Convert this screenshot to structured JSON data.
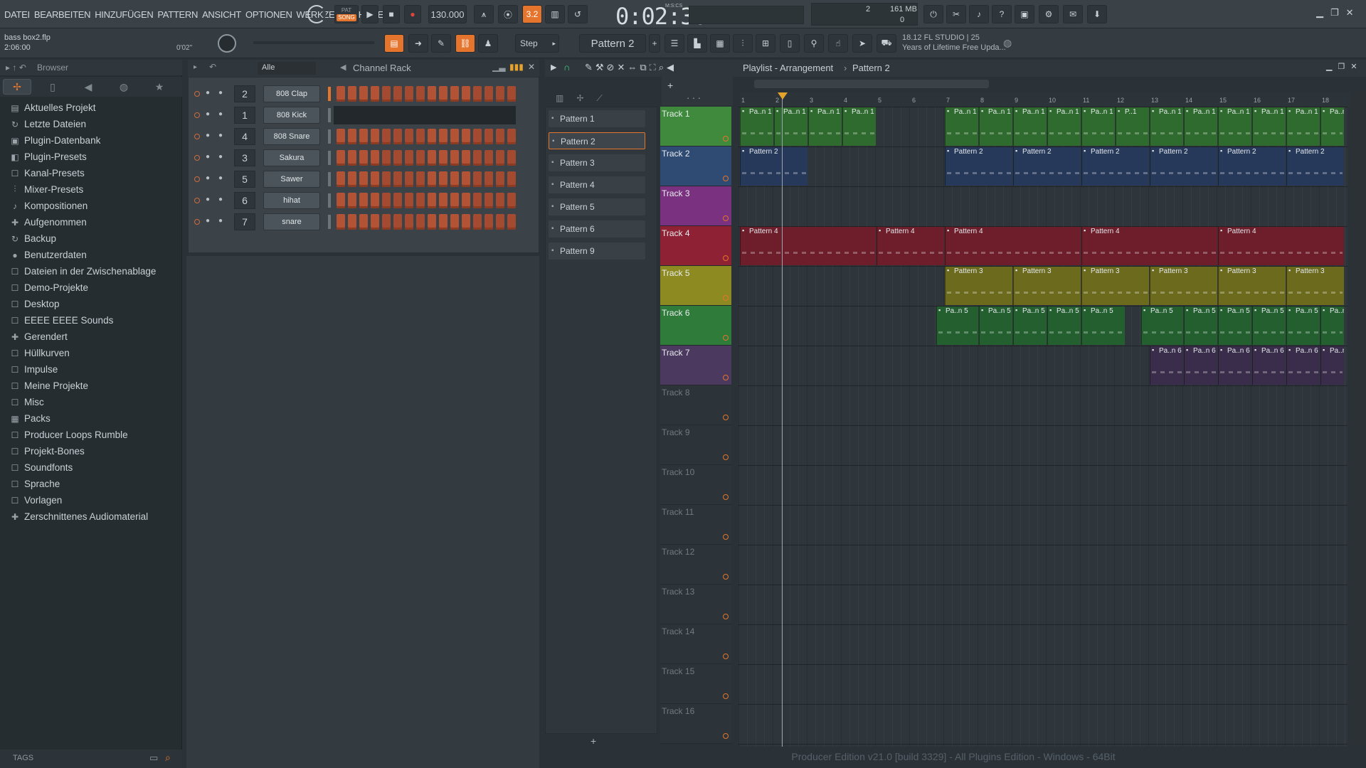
{
  "menu": [
    "DATEI",
    "BEARBEITEN",
    "HINZUFÜGEN",
    "PATTERN",
    "ANSICHT",
    "OPTIONEN",
    "WERKZEUGE",
    "HILFE"
  ],
  "transport": {
    "pat_label": "PAT",
    "song_label": "SONG",
    "tempo": "130.000",
    "time": "0:02:30",
    "time_unit": "M:S:CS",
    "cpu": "2",
    "mem": "161 MB",
    "poly": "0"
  },
  "project": {
    "file": "bass box2.flp",
    "length": "2:06:00",
    "hint_time": "0'02\""
  },
  "snap": "Step",
  "current_pattern": "Pattern 2",
  "news": {
    "line1": "18.12  FL STUDIO | 25",
    "line2": "Years of Lifetime Free Upda..."
  },
  "browser": {
    "title": "Browser",
    "items": [
      {
        "icon": "▤",
        "label": "Aktuelles Projekt"
      },
      {
        "icon": "↻",
        "label": "Letzte Dateien"
      },
      {
        "icon": "▣",
        "label": "Plugin-Datenbank"
      },
      {
        "icon": "◧",
        "label": "Plugin-Presets"
      },
      {
        "icon": "☐",
        "label": "Kanal-Presets"
      },
      {
        "icon": "⫶",
        "label": "Mixer-Presets"
      },
      {
        "icon": "♪",
        "label": "Kompositionen"
      },
      {
        "icon": "✚",
        "label": "Aufgenommen"
      },
      {
        "icon": "↻",
        "label": "Backup"
      },
      {
        "icon": "●",
        "label": "Benutzerdaten"
      },
      {
        "icon": "☐",
        "label": "Dateien in der Zwischenablage"
      },
      {
        "icon": "☐",
        "label": "Demo-Projekte"
      },
      {
        "icon": "☐",
        "label": "Desktop"
      },
      {
        "icon": "☐",
        "label": "EEEE EEEE Sounds"
      },
      {
        "icon": "✚",
        "label": "Gerendert"
      },
      {
        "icon": "☐",
        "label": "Hüllkurven"
      },
      {
        "icon": "☐",
        "label": "Impulse"
      },
      {
        "icon": "☐",
        "label": "Meine Projekte"
      },
      {
        "icon": "☐",
        "label": "Misc"
      },
      {
        "icon": "▦",
        "label": "Packs"
      },
      {
        "icon": "☐",
        "label": "Producer Loops Rumble"
      },
      {
        "icon": "☐",
        "label": "Projekt-Bones"
      },
      {
        "icon": "☐",
        "label": "Soundfonts"
      },
      {
        "icon": "☐",
        "label": "Sprache"
      },
      {
        "icon": "☐",
        "label": "Vorlagen"
      },
      {
        "icon": "✚",
        "label": "Zerschnittenes Audiomaterial"
      }
    ],
    "tags_label": "TAGS"
  },
  "channel_rack": {
    "filter": "Alle",
    "title": "Channel Rack",
    "add": "+",
    "channels": [
      {
        "num": "2",
        "name": "808 Clap",
        "empty": false
      },
      {
        "num": "1",
        "name": "808 Kick",
        "empty": true
      },
      {
        "num": "4",
        "name": "808 Snare",
        "empty": false
      },
      {
        "num": "3",
        "name": "Sakura",
        "empty": false
      },
      {
        "num": "5",
        "name": "Sawer",
        "empty": false
      },
      {
        "num": "6",
        "name": "hihat",
        "empty": false
      },
      {
        "num": "7",
        "name": "snare",
        "empty": false
      }
    ]
  },
  "patterns": [
    "Pattern 1",
    "Pattern 2",
    "Pattern 3",
    "Pattern 4",
    "Pattern 5",
    "Pattern 6",
    "Pattern 9"
  ],
  "active_pattern_index": 1,
  "playlist": {
    "title": "Playlist - Arrangement",
    "crumb": "Pattern 2",
    "bars": [
      "1",
      "2",
      "3",
      "4",
      "5",
      "6",
      "7",
      "8",
      "9",
      "10",
      "11",
      "12",
      "13",
      "14",
      "15",
      "16",
      "17",
      "18"
    ],
    "tracks": [
      {
        "name": "Track 1",
        "color": "#3f8a3c"
      },
      {
        "name": "Track 2",
        "color": "#2f4a73"
      },
      {
        "name": "Track 3",
        "color": "#7a3180"
      },
      {
        "name": "Track 4",
        "color": "#8e2234"
      },
      {
        "name": "Track 5",
        "color": "#8e8a22"
      },
      {
        "name": "Track 6",
        "color": "#2e7b3a"
      },
      {
        "name": "Track 7",
        "color": "#4b3960"
      },
      {
        "name": "Track 8",
        "color": ""
      },
      {
        "name": "Track 9",
        "color": ""
      },
      {
        "name": "Track 10",
        "color": ""
      },
      {
        "name": "Track 11",
        "color": ""
      },
      {
        "name": "Track 12",
        "color": ""
      },
      {
        "name": "Track 13",
        "color": ""
      },
      {
        "name": "Track 14",
        "color": ""
      },
      {
        "name": "Track 15",
        "color": ""
      },
      {
        "name": "Track 16",
        "color": ""
      }
    ],
    "clips": [
      {
        "track": 0,
        "bar": 1,
        "len": 1,
        "label": "Pa..n 1",
        "color": "#2f6b2e"
      },
      {
        "track": 0,
        "bar": 2,
        "len": 1,
        "label": "Pa..n 1",
        "color": "#2f6b2e"
      },
      {
        "track": 0,
        "bar": 3,
        "len": 1,
        "label": "Pa..n 1",
        "color": "#2f6b2e"
      },
      {
        "track": 0,
        "bar": 4,
        "len": 1,
        "label": "Pa..n 1",
        "color": "#2f6b2e"
      },
      {
        "track": 0,
        "bar": 7,
        "len": 1,
        "label": "Pa..n 1",
        "color": "#2f6b2e"
      },
      {
        "track": 0,
        "bar": 8,
        "len": 1,
        "label": "Pa..n 1",
        "color": "#2f6b2e"
      },
      {
        "track": 0,
        "bar": 9,
        "len": 1,
        "label": "Pa..n 1",
        "color": "#2f6b2e"
      },
      {
        "track": 0,
        "bar": 10,
        "len": 1,
        "label": "Pa..n 1",
        "color": "#2f6b2e"
      },
      {
        "track": 0,
        "bar": 11,
        "len": 1,
        "label": "Pa..n 1",
        "color": "#2f6b2e"
      },
      {
        "track": 0,
        "bar": 12,
        "len": 1,
        "label": "P..1",
        "color": "#2f6b2e"
      },
      {
        "track": 0,
        "bar": 13,
        "len": 1,
        "label": "Pa..n 1",
        "color": "#2f6b2e"
      },
      {
        "track": 0,
        "bar": 14,
        "len": 1,
        "label": "Pa..n 1",
        "color": "#2f6b2e"
      },
      {
        "track": 0,
        "bar": 15,
        "len": 1,
        "label": "Pa..n 1",
        "color": "#2f6b2e"
      },
      {
        "track": 0,
        "bar": 16,
        "len": 1,
        "label": "Pa..n 1",
        "color": "#2f6b2e"
      },
      {
        "track": 0,
        "bar": 17,
        "len": 1,
        "label": "Pa..n 1",
        "color": "#2f6b2e"
      },
      {
        "track": 0,
        "bar": 18,
        "len": 0.7,
        "label": "Pa..n 1",
        "color": "#2f6b2e"
      },
      {
        "track": 1,
        "bar": 1,
        "len": 2,
        "label": "Pattern 2",
        "color": "#26395a"
      },
      {
        "track": 1,
        "bar": 7,
        "len": 2,
        "label": "Pattern 2",
        "color": "#26395a"
      },
      {
        "track": 1,
        "bar": 9,
        "len": 2,
        "label": "Pattern 2",
        "color": "#26395a"
      },
      {
        "track": 1,
        "bar": 11,
        "len": 2,
        "label": "Pattern 2",
        "color": "#26395a"
      },
      {
        "track": 1,
        "bar": 13,
        "len": 2,
        "label": "Pattern 2",
        "color": "#26395a"
      },
      {
        "track": 1,
        "bar": 15,
        "len": 2,
        "label": "Pattern 2",
        "color": "#26395a"
      },
      {
        "track": 1,
        "bar": 17,
        "len": 1.7,
        "label": "Pattern 2",
        "color": "#26395a"
      },
      {
        "track": 3,
        "bar": 1,
        "len": 4,
        "label": "Pattern 4",
        "color": "#6e1d2b"
      },
      {
        "track": 3,
        "bar": 5,
        "len": 2,
        "label": "Pattern 4",
        "color": "#6e1d2b"
      },
      {
        "track": 3,
        "bar": 7,
        "len": 4,
        "label": "Pattern 4",
        "color": "#6e1d2b"
      },
      {
        "track": 3,
        "bar": 11,
        "len": 4,
        "label": "Pattern 4",
        "color": "#6e1d2b"
      },
      {
        "track": 3,
        "bar": 15,
        "len": 3.7,
        "label": "Pattern 4",
        "color": "#6e1d2b"
      },
      {
        "track": 4,
        "bar": 7,
        "len": 2,
        "label": "Pattern 3",
        "color": "#6b6a1d"
      },
      {
        "track": 4,
        "bar": 9,
        "len": 2,
        "label": "Pattern 3",
        "color": "#6b6a1d"
      },
      {
        "track": 4,
        "bar": 11,
        "len": 2,
        "label": "Pattern 3",
        "color": "#6b6a1d"
      },
      {
        "track": 4,
        "bar": 13,
        "len": 2,
        "label": "Pattern 3",
        "color": "#6b6a1d"
      },
      {
        "track": 4,
        "bar": 15,
        "len": 2,
        "label": "Pattern 3",
        "color": "#6b6a1d"
      },
      {
        "track": 4,
        "bar": 17,
        "len": 1.7,
        "label": "Pattern 3",
        "color": "#6b6a1d"
      },
      {
        "track": 5,
        "bar": 6.75,
        "len": 1.25,
        "label": "Pa..n 5",
        "color": "#245f2f"
      },
      {
        "track": 5,
        "bar": 8,
        "len": 1,
        "label": "Pa..n 5",
        "color": "#245f2f"
      },
      {
        "track": 5,
        "bar": 9,
        "len": 1,
        "label": "Pa..n 5",
        "color": "#245f2f"
      },
      {
        "track": 5,
        "bar": 10,
        "len": 1,
        "label": "Pa..n 5",
        "color": "#245f2f"
      },
      {
        "track": 5,
        "bar": 11,
        "len": 1.3,
        "label": "Pa..n 5",
        "color": "#245f2f"
      },
      {
        "track": 5,
        "bar": 12.75,
        "len": 1.25,
        "label": "Pa..n 5",
        "color": "#245f2f"
      },
      {
        "track": 5,
        "bar": 14,
        "len": 1,
        "label": "Pa..n 5",
        "color": "#245f2f"
      },
      {
        "track": 5,
        "bar": 15,
        "len": 1,
        "label": "Pa..n 5",
        "color": "#245f2f"
      },
      {
        "track": 5,
        "bar": 16,
        "len": 1,
        "label": "Pa..n 5",
        "color": "#245f2f"
      },
      {
        "track": 5,
        "bar": 17,
        "len": 1,
        "label": "Pa..n 5",
        "color": "#245f2f"
      },
      {
        "track": 5,
        "bar": 18,
        "len": 0.7,
        "label": "Pa..n 5",
        "color": "#245f2f"
      },
      {
        "track": 6,
        "bar": 13,
        "len": 1,
        "label": "Pa..n 6",
        "color": "#3a2c4b"
      },
      {
        "track": 6,
        "bar": 14,
        "len": 1,
        "label": "Pa..n 6",
        "color": "#3a2c4b"
      },
      {
        "track": 6,
        "bar": 15,
        "len": 1,
        "label": "Pa..n 6",
        "color": "#3a2c4b"
      },
      {
        "track": 6,
        "bar": 16,
        "len": 1,
        "label": "Pa..n 6",
        "color": "#3a2c4b"
      },
      {
        "track": 6,
        "bar": 17,
        "len": 1,
        "label": "Pa..n 6",
        "color": "#3a2c4b"
      },
      {
        "track": 6,
        "bar": 18,
        "len": 0.7,
        "label": "Pa..n 6",
        "color": "#3a2c4b"
      }
    ]
  },
  "status": "Producer Edition v21.0 [build 3329] - All Plugins Edition - Windows - 64Bit"
}
